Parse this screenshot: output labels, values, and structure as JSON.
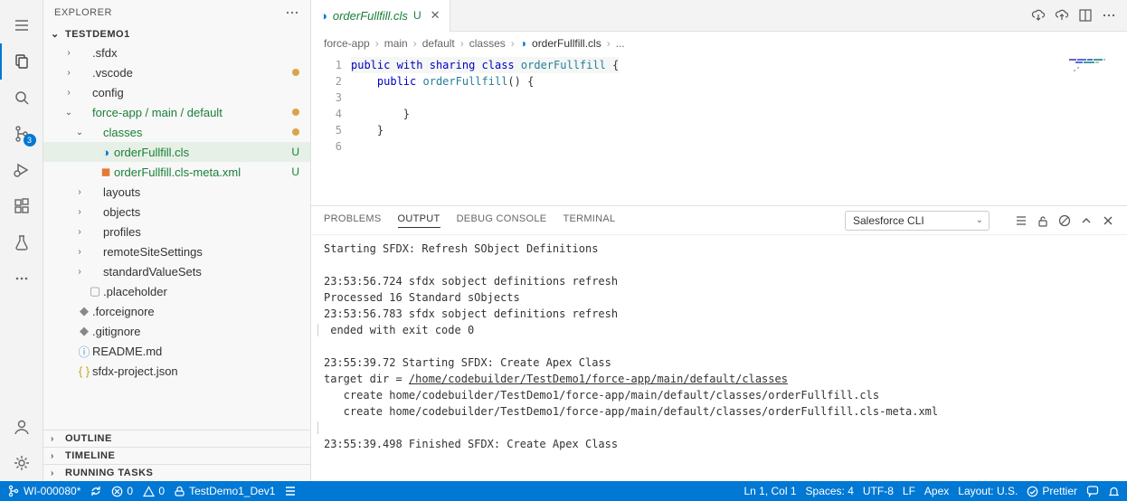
{
  "sidebar": {
    "title": "EXPLORER",
    "folder": "TESTDEMO1",
    "items": [
      {
        "label": ".sfdx",
        "depth": 1,
        "chevron": ">",
        "icon": "",
        "green": false,
        "dot": false,
        "u": false
      },
      {
        "label": ".vscode",
        "depth": 1,
        "chevron": ">",
        "icon": "",
        "green": false,
        "dot": true,
        "u": false
      },
      {
        "label": "config",
        "depth": 1,
        "chevron": ">",
        "icon": "",
        "green": false,
        "dot": false,
        "u": false
      },
      {
        "label": "force-app / main / default",
        "depth": 1,
        "chevron": "v",
        "icon": "",
        "green": true,
        "dot": true,
        "u": false
      },
      {
        "label": "classes",
        "depth": 2,
        "chevron": "v",
        "icon": "",
        "green": true,
        "dot": true,
        "u": false
      },
      {
        "label": "orderFullfill.cls",
        "depth": 3,
        "chevron": "",
        "icon": "apex",
        "green": true,
        "dot": false,
        "u": true,
        "selected": true
      },
      {
        "label": "orderFullfill.cls-meta.xml",
        "depth": 3,
        "chevron": "",
        "icon": "xml",
        "green": true,
        "dot": false,
        "u": true
      },
      {
        "label": "layouts",
        "depth": 2,
        "chevron": ">",
        "icon": "",
        "green": false,
        "dot": false,
        "u": false
      },
      {
        "label": "objects",
        "depth": 2,
        "chevron": ">",
        "icon": "",
        "green": false,
        "dot": false,
        "u": false
      },
      {
        "label": "profiles",
        "depth": 2,
        "chevron": ">",
        "icon": "",
        "green": false,
        "dot": false,
        "u": false
      },
      {
        "label": "remoteSiteSettings",
        "depth": 2,
        "chevron": ">",
        "icon": "",
        "green": false,
        "dot": false,
        "u": false
      },
      {
        "label": "standardValueSets",
        "depth": 2,
        "chevron": ">",
        "icon": "",
        "green": false,
        "dot": false,
        "u": false
      },
      {
        "label": ".placeholder",
        "depth": 2,
        "chevron": "",
        "icon": "file",
        "green": false,
        "dot": false,
        "u": false
      },
      {
        "label": ".forceignore",
        "depth": 1,
        "chevron": "",
        "icon": "diamond",
        "green": false,
        "dot": false,
        "u": false
      },
      {
        "label": ".gitignore",
        "depth": 1,
        "chevron": "",
        "icon": "diamond",
        "green": false,
        "dot": false,
        "u": false
      },
      {
        "label": "README.md",
        "depth": 1,
        "chevron": "",
        "icon": "info",
        "green": false,
        "dot": false,
        "u": false
      },
      {
        "label": "sfdx-project.json",
        "depth": 1,
        "chevron": "",
        "icon": "json",
        "green": false,
        "dot": false,
        "u": false
      }
    ],
    "sections": [
      "OUTLINE",
      "TIMELINE",
      "RUNNING TASKS"
    ]
  },
  "activity_badge": "3",
  "tab": {
    "name": "orderFullfill.cls",
    "badge": "U"
  },
  "breadcrumbs": [
    "force-app",
    "main",
    "default",
    "classes",
    "orderFullfill.cls",
    "..."
  ],
  "code": {
    "lines": [
      "1",
      "2",
      "3",
      "4",
      "5",
      "6"
    ],
    "l1_kw1": "public",
    "l1_kw2": "with sharing",
    "l1_kw3": "class",
    "l1_cls": "orderFullfill",
    "l1_brace": " {",
    "l2_kw": "public",
    "l2_name": "orderFullfill",
    "l2_rest": "() {",
    "l3": "",
    "l4": "        }",
    "l5": "    }",
    "l6": ""
  },
  "panel": {
    "tabs": [
      "PROBLEMS",
      "OUTPUT",
      "DEBUG CONSOLE",
      "TERMINAL"
    ],
    "active": 1,
    "selector": "Salesforce CLI",
    "output": {
      "l01": "Starting SFDX: Refresh SObject Definitions",
      "l02": "",
      "l03": "23:53:56.724 sfdx sobject definitions refresh",
      "l04": "Processed 16 Standard sObjects",
      "l05": "23:53:56.783 sfdx sobject definitions refresh",
      "l06": " ended with exit code 0",
      "l07": "",
      "l08": "23:55:39.72 Starting SFDX: Create Apex Class",
      "l09a": "target dir = ",
      "l09b": "/home/codebuilder/TestDemo1/force-app/main/default/classes",
      "l10": "   create home/codebuilder/TestDemo1/force-app/main/default/classes/orderFullfill.cls",
      "l11": "   create home/codebuilder/TestDemo1/force-app/main/default/classes/orderFullfill.cls-meta.xml",
      "l12": "",
      "l13": "23:55:39.498 Finished SFDX: Create Apex Class"
    }
  },
  "status": {
    "branch": "WI-000080*",
    "errors": "0",
    "warnings": "0",
    "org": "TestDemo1_Dev1",
    "pos": "Ln 1, Col 1",
    "spaces": "Spaces: 4",
    "encoding": "UTF-8",
    "eol": "LF",
    "lang": "Apex",
    "layout": "Layout: U.S.",
    "prettier": "Prettier"
  }
}
